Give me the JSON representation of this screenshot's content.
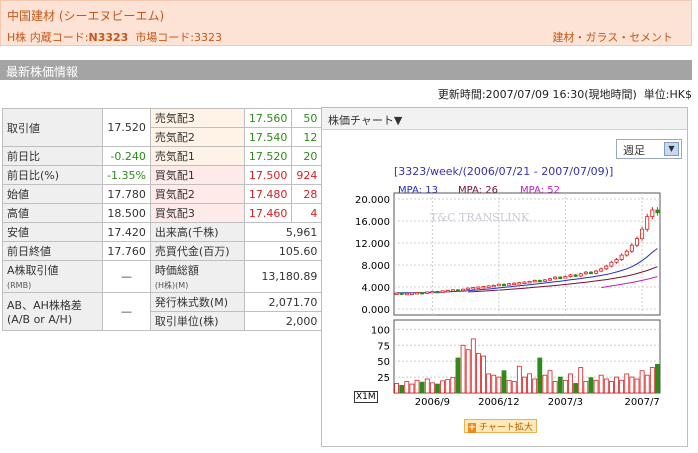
{
  "header": {
    "name": "中国建材 (シーエヌビーエム)",
    "codes_prefix": "H株  内蔵コード:",
    "internal_code": "N3323",
    "market_code": "市場コード:3323",
    "industry": "建材・ガラス・セメント"
  },
  "section_title": "最新株価情報",
  "update_time": "更新時間:2007/07/09 16:30(現地時間)",
  "unit": "単位:HK$",
  "quote": {
    "last_price_label": "取引値",
    "last_price": "17.520",
    "change_label": "前日比",
    "change": "-0.240",
    "change_pct_label": "前日比(%)",
    "change_pct": "-1.35%",
    "open_label": "始値",
    "open": "17.780",
    "high_label": "高値",
    "high": "18.500",
    "low_label": "安値",
    "low": "17.420",
    "prev_close_label": "前日終値",
    "prev_close": "17.760",
    "a_price_label": "A株取引値",
    "a_price_unit": "(RMB)",
    "a_price": "—",
    "ah_ratio_label_1": "AB、AH株格差",
    "ah_ratio_label_2": "(A/B or A/H)",
    "ah_ratio": "—",
    "ask3_label": "売気配3",
    "ask3_price": "17.560",
    "ask3_qty": "50",
    "ask2_label": "売気配2",
    "ask2_price": "17.540",
    "ask2_qty": "12",
    "ask1_label": "売気配1",
    "ask1_price": "17.520",
    "ask1_qty": "20",
    "bid1_label": "買気配1",
    "bid1_price": "17.500",
    "bid1_qty": "924",
    "bid2_label": "買気配2",
    "bid2_price": "17.480",
    "bid2_qty": "28",
    "bid3_label": "買気配3",
    "bid3_price": "17.460",
    "bid3_qty": "4",
    "volume_label": "出来高(千株)",
    "volume": "5,961",
    "turnover_label": "売買代金(百万)",
    "turnover": "105.60",
    "mcap_label": "時価総額",
    "mcap_unit": "(H株)(M)",
    "mcap": "13,180.89",
    "shares_label": "発行株式数(M)",
    "shares": "2,071.70",
    "lot_label": "取引単位(株)",
    "lot": "2,000"
  },
  "chart_panel": {
    "title": "株価チャート▼",
    "period_select": "週足",
    "chart_title": "[3323/week/(2006/07/21 - 2007/07/09)]",
    "mpa13": "MPA: 13",
    "mpa26": "MPA: 26",
    "mpa52": "MPA: 52",
    "watermark": "T&C TRANSLINK",
    "vol_unit": "X1M",
    "enlarge_button": "チャート拡大"
  },
  "colors": {
    "up": "#d81e1e",
    "down": "#2e8b1a",
    "ma13": "#1f2fc4",
    "ma26": "#7a1030",
    "ma52": "#c020c0"
  },
  "chart_data": {
    "type": "candlestick",
    "title": "[3323/week/(2006/07/21 - 2007/07/09)]",
    "x_ticks": [
      "2006/9",
      "2006/12",
      "2007/3",
      "2007/7"
    ],
    "price_ticks": [
      "20.000",
      "16.000",
      "12.000",
      "8.000",
      "4.000",
      "0.000"
    ],
    "price_range": [
      0,
      20
    ],
    "volume_ticks": [
      "100",
      "75",
      "50",
      "25"
    ],
    "volume_range": [
      0,
      110
    ],
    "volume_unit": "X1M",
    "close": [
      2.9,
      2.8,
      2.85,
      2.9,
      3.0,
      2.95,
      3.1,
      3.2,
      3.15,
      3.3,
      3.4,
      3.5,
      3.45,
      3.6,
      3.8,
      3.9,
      4.0,
      4.1,
      4.2,
      4.3,
      4.5,
      4.4,
      4.6,
      4.7,
      4.8,
      4.9,
      5.0,
      5.2,
      5.1,
      5.3,
      5.5,
      5.8,
      5.6,
      5.9,
      6.2,
      6.0,
      6.4,
      6.7,
      6.5,
      6.9,
      7.3,
      7.8,
      8.5,
      9.0,
      9.8,
      10.5,
      11.6,
      12.8,
      14.5,
      16.8,
      18.0,
      17.5
    ],
    "volume": [
      15,
      12,
      18,
      14,
      20,
      17,
      22,
      16,
      14,
      19,
      21,
      24,
      55,
      75,
      68,
      85,
      62,
      58,
      30,
      28,
      25,
      35,
      20,
      18,
      42,
      25,
      30,
      22,
      55,
      28,
      35,
      18,
      25,
      20,
      30,
      15,
      40,
      18,
      24,
      20,
      28,
      22,
      18,
      25,
      20,
      30,
      25,
      22,
      35,
      28,
      40,
      45
    ],
    "ma13": [
      2.95,
      2.95,
      2.95,
      2.95,
      2.96,
      2.97,
      3.0,
      3.02,
      3.05,
      3.08,
      3.12,
      3.16,
      3.2,
      3.26,
      3.33,
      3.4,
      3.48,
      3.56,
      3.64,
      3.73,
      3.83,
      3.92,
      4.02,
      4.12,
      4.22,
      4.32,
      4.42,
      4.52,
      4.62,
      4.72,
      4.83,
      4.95,
      5.05,
      5.18,
      5.3,
      5.42,
      5.55,
      5.68,
      5.8,
      5.94,
      6.1,
      6.28,
      6.5,
      6.72,
      7.0,
      7.3,
      7.7,
      8.2,
      8.8,
      9.5,
      10.3,
      11.0
    ],
    "ma26": [
      null,
      null,
      null,
      null,
      null,
      null,
      null,
      null,
      null,
      null,
      null,
      null,
      null,
      null,
      3.1,
      3.15,
      3.2,
      3.26,
      3.32,
      3.38,
      3.44,
      3.5,
      3.57,
      3.64,
      3.71,
      3.78,
      3.86,
      3.94,
      4.02,
      4.1,
      4.19,
      4.28,
      4.37,
      4.46,
      4.56,
      4.66,
      4.76,
      4.87,
      4.98,
      5.1,
      5.22,
      5.35,
      5.5,
      5.65,
      5.82,
      6.0,
      6.2,
      6.45,
      6.72,
      7.0,
      7.35,
      7.7
    ],
    "ma52": [
      null,
      null,
      null,
      null,
      null,
      null,
      null,
      null,
      null,
      null,
      null,
      null,
      null,
      null,
      null,
      null,
      null,
      null,
      null,
      null,
      null,
      null,
      null,
      null,
      null,
      null,
      null,
      null,
      null,
      null,
      null,
      null,
      null,
      null,
      null,
      null,
      null,
      null,
      null,
      null,
      3.9,
      4.05,
      4.2,
      4.35,
      4.5,
      4.66,
      4.82,
      5.0,
      5.2,
      5.4,
      5.65,
      5.9
    ]
  }
}
